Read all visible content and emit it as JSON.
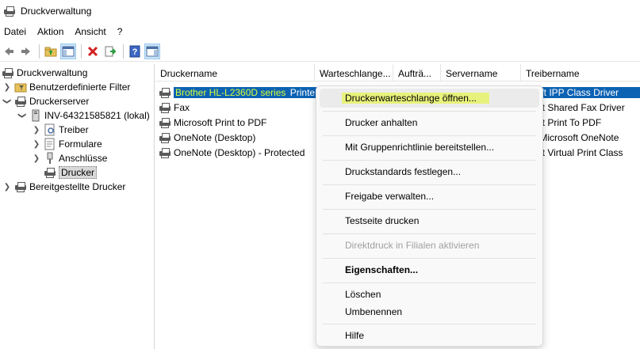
{
  "window": {
    "title": "Druckverwaltung"
  },
  "menubar": {
    "items": [
      "Datei",
      "Aktion",
      "Ansicht",
      "?"
    ]
  },
  "toolbar": {
    "buttons": [
      "back-icon",
      "forward-icon",
      "up-folder-icon",
      "show-hide-tree-icon",
      "delete-icon",
      "export-icon",
      "help-icon",
      "action-pane-icon"
    ]
  },
  "tree": {
    "root": "Druckverwaltung",
    "custom_filters": "Benutzerdefinierte Filter",
    "print_servers": "Druckerserver",
    "server": "INV-64321585821 (lokal)",
    "drivers": "Treiber",
    "forms": "Formulare",
    "ports": "Anschlüsse",
    "printers": "Drucker",
    "deployed": "Bereitgestellte Drucker"
  },
  "list": {
    "columns": [
      "Druckername",
      "Warteschlange...",
      "Aufträ...",
      "Servername",
      "Treibername"
    ],
    "rows": [
      {
        "name_highlight": "Brother HL-L2360D series",
        "name_rest": " Printer",
        "driver": "rosoft IPP Class Driver"
      },
      {
        "name": "Fax",
        "driver": "rosoft Shared Fax Driver"
      },
      {
        "name": "Microsoft Print to PDF",
        "driver": "rosoft Print To PDF"
      },
      {
        "name": "OneNote (Desktop)",
        "driver": "d to Microsoft OneNote"
      },
      {
        "name": "OneNote (Desktop) - Protected",
        "driver": "rosoft Virtual Print Class"
      }
    ]
  },
  "context_menu": {
    "open_queue": "Druckerwarteschlange öffnen...",
    "pause": "Drucker anhalten",
    "deploy_gpo": "Mit Gruppenrichtlinie bereitstellen...",
    "set_defaults": "Druckstandards festlegen...",
    "manage_sharing": "Freigabe verwalten...",
    "test_page": "Testseite drucken",
    "branch_direct": "Direktdruck in Filialen aktivieren",
    "properties": "Eigenschaften...",
    "delete": "Löschen",
    "rename": "Umbenennen",
    "help": "Hilfe"
  },
  "colors": {
    "selection_blue": "#0c62b3",
    "highlight_yellow": "#e7f27c",
    "menu_hover": "#ebebeb"
  }
}
